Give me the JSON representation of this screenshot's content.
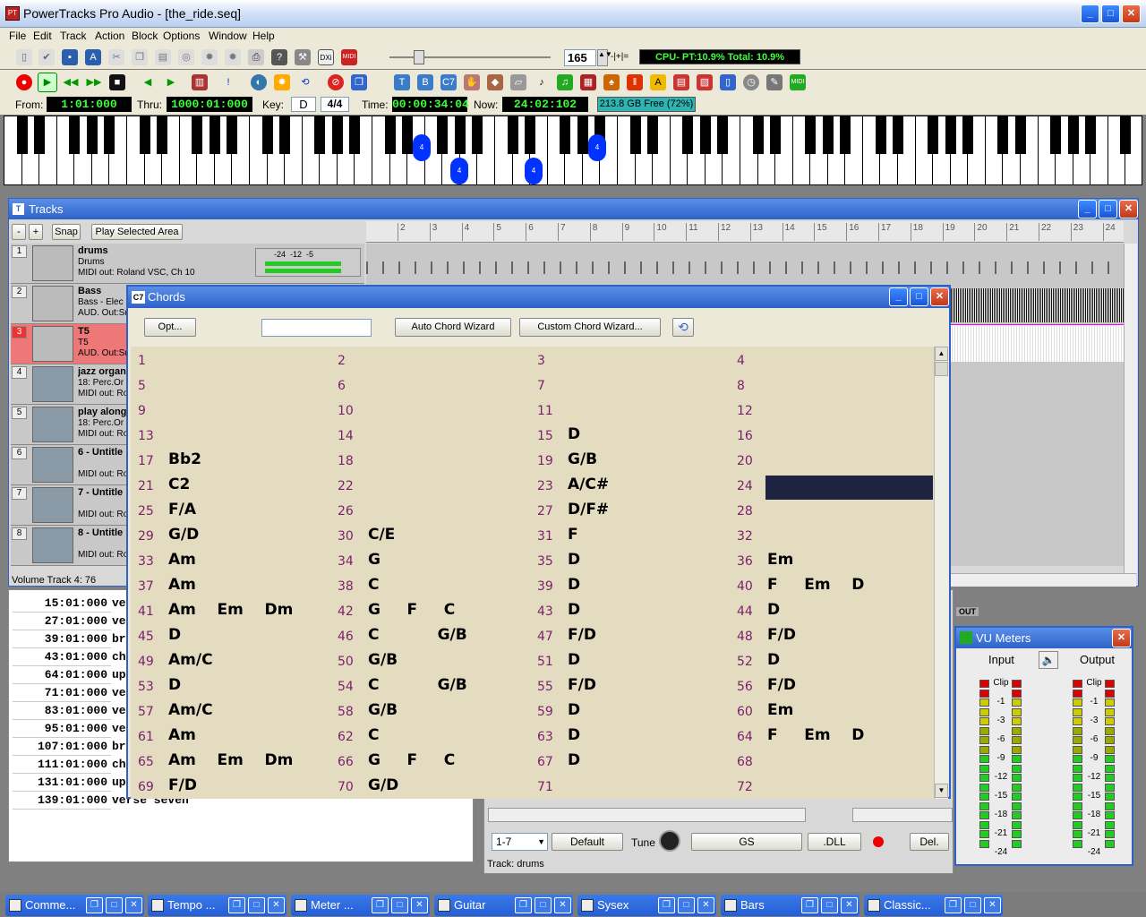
{
  "window": {
    "title": "PowerTracks Pro Audio - [the_ride.seq]"
  },
  "menu": [
    "File",
    "Edit",
    "Track",
    "Action",
    "Block",
    "Options",
    "Window",
    "Help"
  ],
  "toolbar1": {
    "tempo": "165",
    "cpu": "CPU- PT:10.9% Total: 10.9%"
  },
  "transport": {
    "from_label": "From:",
    "from": "1:01:000",
    "thru_label": "Thru:",
    "thru": "1000:01:000",
    "key_label": "Key:",
    "key": "D",
    "timesig": "4/4",
    "time_label": "Time:",
    "time": "00:00:34:04",
    "now_label": "Now:",
    "now": "24:02:102",
    "disk": "213.8 GB Free (72%)"
  },
  "piano": {
    "marker": "4"
  },
  "tracks": {
    "title": "Tracks",
    "minus": "-",
    "plus": "+",
    "snap": "Snap",
    "play_sel": "Play Selected Area",
    "ruler": [
      "2",
      "3",
      "4",
      "5",
      "6",
      "7",
      "8",
      "9",
      "10",
      "11",
      "12",
      "13",
      "14",
      "15",
      "16",
      "17",
      "18",
      "19",
      "20",
      "21",
      "22",
      "23",
      "24"
    ],
    "rows": [
      {
        "num": "1",
        "name": "drums",
        "l2": "Drums",
        "l3": "MIDI out: Roland VSC, Ch 10"
      },
      {
        "num": "2",
        "name": "Bass",
        "l2": "Bass - Elec",
        "l3": "AUD. Out:Su"
      },
      {
        "num": "3",
        "name": "T5",
        "l2": "T5",
        "l3": "AUD. Out:Su"
      },
      {
        "num": "4",
        "name": "jazz organ",
        "l2": "18: Perc.Or",
        "l3": "MIDI out: Ro"
      },
      {
        "num": "5",
        "name": "play along",
        "l2": "18: Perc.Or",
        "l3": "MIDI out: Ro"
      },
      {
        "num": "6",
        "name": "6 - Untitle",
        "l2": "",
        "l3": "MIDI out: Ro"
      },
      {
        "num": "7",
        "name": "7 - Untitle",
        "l2": "",
        "l3": "MIDI out: Ro"
      },
      {
        "num": "8",
        "name": "8 - Untitle",
        "l2": "",
        "l3": "MIDI out: Ro"
      }
    ],
    "meter_scale": "-24  -12  -5",
    "volume_status": "Volume Track 4: 76"
  },
  "events": [
    {
      "t": "15:01:000",
      "v": "ve"
    },
    {
      "t": "27:01:000",
      "v": "ve"
    },
    {
      "t": "39:01:000",
      "v": "br"
    },
    {
      "t": "43:01:000",
      "v": "ch"
    },
    {
      "t": "64:01:000",
      "v": "up"
    },
    {
      "t": "71:01:000",
      "v": "ve"
    },
    {
      "t": "83:01:000",
      "v": "ve"
    },
    {
      "t": "95:01:000",
      "v": "ve"
    },
    {
      "t": "107:01:000",
      "v": "br"
    },
    {
      "t": "111:01:000",
      "v": "ch"
    },
    {
      "t": "131:01:000",
      "v": "up"
    },
    {
      "t": "139:01:000",
      "v": "verse seven"
    }
  ],
  "chords": {
    "title": "Chords",
    "opt": "Opt...",
    "auto": "Auto Chord Wizard",
    "custom": "Custom Chord Wizard...",
    "bars": [
      [
        "1",
        ""
      ],
      [
        "2",
        ""
      ],
      [
        "3",
        ""
      ],
      [
        "4",
        ""
      ],
      [
        "5",
        ""
      ],
      [
        "6",
        ""
      ],
      [
        "7",
        ""
      ],
      [
        "8",
        ""
      ],
      [
        "9",
        ""
      ],
      [
        "10",
        ""
      ],
      [
        "11",
        ""
      ],
      [
        "12",
        ""
      ],
      [
        "13",
        ""
      ],
      [
        "14",
        ""
      ],
      [
        "15",
        "D"
      ],
      [
        "16",
        ""
      ],
      [
        "17",
        "Bb2"
      ],
      [
        "18",
        ""
      ],
      [
        "19",
        "G/B"
      ],
      [
        "20",
        ""
      ],
      [
        "21",
        "C2"
      ],
      [
        "22",
        ""
      ],
      [
        "23",
        "A/C#"
      ],
      [
        "24",
        ""
      ],
      [
        "25",
        "F/A"
      ],
      [
        "26",
        ""
      ],
      [
        "27",
        "D/F#"
      ],
      [
        "28",
        ""
      ],
      [
        "29",
        "G/D"
      ],
      [
        "30",
        "C/E"
      ],
      [
        "31",
        "F"
      ],
      [
        "32",
        ""
      ],
      [
        "33",
        "Am"
      ],
      [
        "34",
        "G"
      ],
      [
        "35",
        "D"
      ],
      [
        "36",
        "Em"
      ],
      [
        "37",
        "Am"
      ],
      [
        "38",
        "C"
      ],
      [
        "39",
        "D"
      ],
      [
        "40",
        "F     Em    D"
      ],
      [
        "41",
        "Am    Em    Dm"
      ],
      [
        "42",
        "G     F     C"
      ],
      [
        "43",
        "D"
      ],
      [
        "44",
        "D"
      ],
      [
        "45",
        "D"
      ],
      [
        "46",
        "C           G/B"
      ],
      [
        "47",
        "F/D"
      ],
      [
        "48",
        "F/D"
      ],
      [
        "49",
        "Am/C"
      ],
      [
        "50",
        "G/B"
      ],
      [
        "51",
        "D"
      ],
      [
        "52",
        "D"
      ],
      [
        "53",
        "D"
      ],
      [
        "54",
        "C           G/B"
      ],
      [
        "55",
        "F/D"
      ],
      [
        "56",
        "F/D"
      ],
      [
        "57",
        "Am/C"
      ],
      [
        "58",
        "G/B"
      ],
      [
        "59",
        "D"
      ],
      [
        "60",
        "Em"
      ],
      [
        "61",
        "Am"
      ],
      [
        "62",
        "C"
      ],
      [
        "63",
        "D"
      ],
      [
        "64",
        "F     Em    D"
      ],
      [
        "65",
        "Am    Em    Dm"
      ],
      [
        "66",
        "G     F     C"
      ],
      [
        "67",
        "D"
      ],
      [
        "68",
        ""
      ],
      [
        "69",
        "F/D"
      ],
      [
        "70",
        "G/D"
      ],
      [
        "71",
        ""
      ],
      [
        "72",
        ""
      ]
    ]
  },
  "mixer": {
    "preset": "1-7",
    "default": "Default",
    "tune": "Tune",
    "gs": "GS",
    "dll": ".DLL",
    "del": "Del.",
    "status": "Track: drums",
    "out": "OUT"
  },
  "vu": {
    "title": "VU Meters",
    "input": "Input",
    "output": "Output",
    "scale": [
      "Clip",
      "-1",
      "-3",
      "-6",
      "-9",
      "-12",
      "-15",
      "-18",
      "-21",
      "-24"
    ]
  },
  "taskbar": [
    "Comme...",
    "Tempo ...",
    "Meter ...",
    "Guitar",
    "Sysex",
    "Bars",
    "Classic..."
  ],
  "colors": {
    "accent": "#2f62c9",
    "chord_bg": "#e4dcc0",
    "selected_cell": "#1d2340",
    "number": "#7a1f6b"
  }
}
